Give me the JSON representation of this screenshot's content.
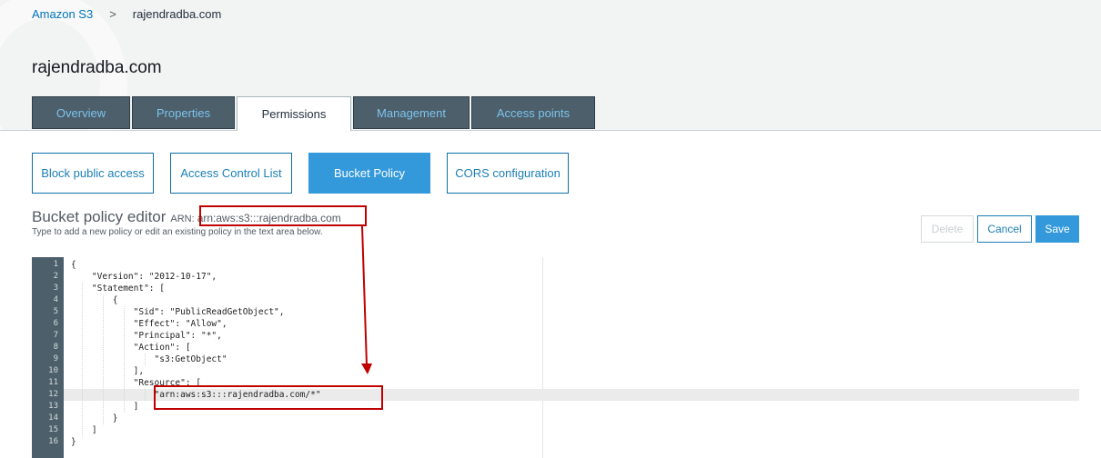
{
  "breadcrumb": {
    "root": "Amazon S3",
    "separator": ">",
    "current": "rajendradba.com"
  },
  "page_title": "rajendradba.com",
  "tabs": [
    {
      "label": "Overview",
      "active": false
    },
    {
      "label": "Properties",
      "active": false
    },
    {
      "label": "Permissions",
      "active": true
    },
    {
      "label": "Management",
      "active": false
    },
    {
      "label": "Access points",
      "active": false
    }
  ],
  "subnav": [
    {
      "label": "Block public access",
      "active": false
    },
    {
      "label": "Access Control List",
      "active": false
    },
    {
      "label": "Bucket Policy",
      "active": true
    },
    {
      "label": "CORS configuration",
      "active": false
    }
  ],
  "editor": {
    "title": "Bucket policy editor",
    "arn_label": "ARN:",
    "arn_value": "arn:aws:s3:::rajendradba.com",
    "hint": "Type to add a new policy or edit an existing policy in the text area below.",
    "active_line": 12,
    "lines": [
      "{",
      "    \"Version\": \"2012-10-17\",",
      "    \"Statement\": [",
      "        {",
      "            \"Sid\": \"PublicReadGetObject\",",
      "            \"Effect\": \"Allow\",",
      "            \"Principal\": \"*\",",
      "            \"Action\": [",
      "                \"s3:GetObject\"",
      "            ],",
      "            \"Resource\": [",
      "                \"arn:aws:s3:::rajendradba.com/*\"",
      "            ]",
      "        }",
      "    ]",
      "}"
    ]
  },
  "actions": {
    "delete": "Delete",
    "cancel": "Cancel",
    "save": "Save"
  },
  "colors": {
    "accent": "#3499db",
    "tab_bg": "#4c5f6b",
    "annotation": "#c00000"
  }
}
